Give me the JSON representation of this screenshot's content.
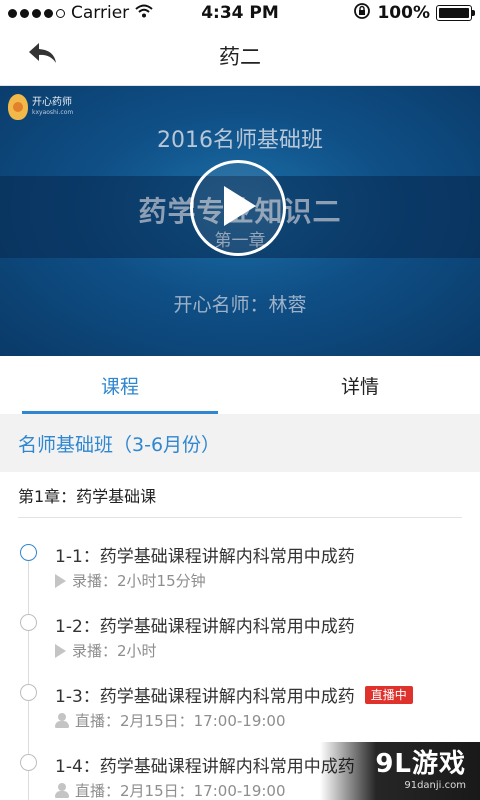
{
  "status_bar": {
    "carrier": "Carrier",
    "time": "4:34 PM",
    "battery": "100%",
    "battery_level": 1.0
  },
  "nav": {
    "title": "药二",
    "back_icon": "back-arrow-icon"
  },
  "video": {
    "logo_name": "开心药师",
    "logo_url": "kxyaoshi.com",
    "line1": "2016名师基础班",
    "line2": "药学专业知识二",
    "line3": "第一章",
    "line4": "开心名师：林蓉",
    "play_icon": "play-icon"
  },
  "tabs": [
    {
      "label": "课程",
      "active": true
    },
    {
      "label": "详情",
      "active": false
    }
  ],
  "section": {
    "title": "名师基础班（3-6月份）"
  },
  "chapter": {
    "title": "第1章：药学基础课"
  },
  "lessons": [
    {
      "title": "1-1：药学基础课程讲解内科常用中成药",
      "meta": "录播：2小时15分钟",
      "type": "recorded",
      "active": true,
      "badge": ""
    },
    {
      "title": "1-2：药学基础课程讲解内科常用中成药",
      "meta": "录播：2小时",
      "type": "recorded",
      "active": false,
      "badge": ""
    },
    {
      "title": "1-3：药学基础课程讲解内科常用中成药",
      "meta": "直播：2月15日：17:00-19:00",
      "type": "live",
      "active": false,
      "badge": "直播中"
    },
    {
      "title": "1-4：药学基础课程讲解内科常用中成药",
      "meta": "直播：2月15日：17:00-19:00",
      "type": "live",
      "active": false,
      "badge": ""
    }
  ],
  "watermark": {
    "main": "9L游戏",
    "sub": "91danji.com"
  },
  "colors": {
    "accent": "#2f87d0",
    "live_badge": "#e0322d"
  }
}
